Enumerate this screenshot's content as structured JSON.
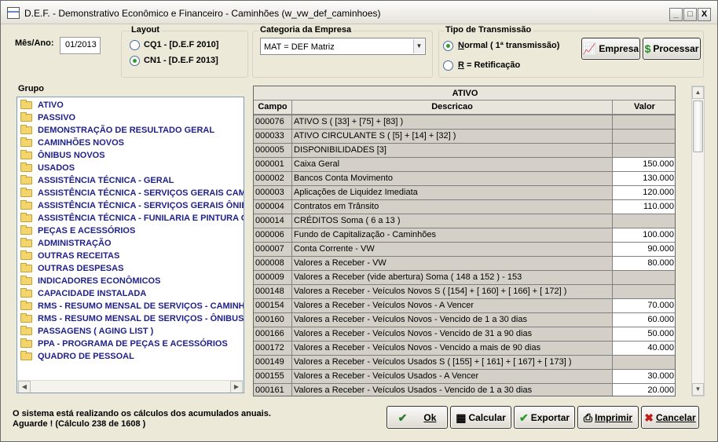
{
  "window": {
    "title": "D.E.F. - Demonstrativo Econômico e Financeiro - Caminhões (w_vw_def_caminhoes)",
    "min": "_",
    "max": "□",
    "close": "X"
  },
  "period": {
    "label": "Mês/Ano:",
    "value": "01/2013"
  },
  "layout": {
    "label": "Layout",
    "opt1": "CQ1 - [D.E.F 2010]",
    "opt2": "CN1 - [D.E.F 2013]",
    "selected": "CN1 - [D.E.F 2013]"
  },
  "category": {
    "label": "Categoria da Empresa",
    "value": "MAT = DEF Matriz"
  },
  "transmission": {
    "label": "Tipo de Transmissão",
    "opt_normal_key": "N",
    "opt_normal_rest": "ormal ( 1ª transmissão)",
    "opt_retif_key": "R",
    "opt_retif_rest": " = Retificação",
    "selected": "Normal"
  },
  "buttons": {
    "empresa": "Empresa",
    "processar": "Processar",
    "ok": "Ok",
    "calcular": "Calcular",
    "exportar": "Exportar",
    "imprimir": "Imprimir",
    "cancelar": "Cancelar"
  },
  "group": {
    "label": "Grupo",
    "items": [
      "ATIVO",
      "PASSIVO",
      "DEMONSTRAÇÃO DE RESULTADO GERAL",
      "CAMINHÕES NOVOS",
      "ÔNIBUS NOVOS",
      "USADOS",
      "ASSISTÊNCIA TÉCNICA - GERAL",
      "ASSISTÊNCIA TÉCNICA - SERVIÇOS GERAIS CAMIN",
      "ASSISTÊNCIA TÉCNICA - SERVIÇOS GERAIS ÔNIBU",
      "ASSISTÊNCIA TÉCNICA - FUNILARIA E PINTURA GE",
      "PEÇAS E ACESSÓRIOS",
      "ADMINISTRAÇÃO",
      "OUTRAS RECEITAS",
      "OUTRAS DESPESAS",
      "INDICADORES ECONÔMICOS",
      "CAPACIDADE INSTALADA",
      "RMS - RESUMO MENSAL DE SERVIÇOS - CAMINHÕ",
      "RMS - RESUMO MENSAL DE SERVIÇOS - ÔNIBUS",
      "PASSAGENS ( AGING LIST )",
      "PPA - PROGRAMA DE PEÇAS E ACESSÓRIOS",
      "QUADRO DE PESSOAL"
    ]
  },
  "grid": {
    "title": "ATIVO",
    "columns": [
      "Campo",
      "Descricao",
      "Valor"
    ],
    "rows": [
      [
        "000076",
        "ATIVO S ( [33] + [75] + [83] )",
        ""
      ],
      [
        "000033",
        "ATIVO CIRCULANTE S ( [5] + [14] + [32] )",
        ""
      ],
      [
        "000005",
        "DISPONIBILIDADES [3]",
        ""
      ],
      [
        "000001",
        "Caixa Geral",
        "150.000"
      ],
      [
        "000002",
        "Bancos Conta Movimento",
        "130.000"
      ],
      [
        "000003",
        "Aplicações de Liquidez Imediata",
        "120.000"
      ],
      [
        "000004",
        "Contratos em Trânsito",
        "110.000"
      ],
      [
        "000014",
        "CRÉDITOS Soma ( 6 a 13 )",
        ""
      ],
      [
        "000006",
        "Fundo de Capitalização - Caminhões",
        "100.000"
      ],
      [
        "000007",
        "Conta Corrente - VW",
        "90.000"
      ],
      [
        "000008",
        "Valores a Receber - VW",
        "80.000"
      ],
      [
        "000009",
        "Valores a Receber (vide abertura) Soma ( 148 a 152 ) - 153",
        ""
      ],
      [
        "000148",
        "Valores a Receber - Veículos Novos S ( [154] + [ 160] + [ 166] + [ 172] )",
        ""
      ],
      [
        "000154",
        "Valores a Receber - Veículos Novos - A Vencer",
        "70.000"
      ],
      [
        "000160",
        "Valores a Receber - Veículos Novos - Vencido de 1 a 30 dias",
        "60.000"
      ],
      [
        "000166",
        "Valores a Receber - Veículos Novos - Vencido de 31 a 90 dias",
        "50.000"
      ],
      [
        "000172",
        "Valores a Receber - Veículos Novos - Vencido a mais de 90 dias",
        "40.000"
      ],
      [
        "000149",
        "Valores a Receber - Veículos Usados S ( [155] + [ 161] + [ 167] + [ 173] )",
        ""
      ],
      [
        "000155",
        "Valores a Receber - Veículos Usados - A Vencer",
        "30.000"
      ],
      [
        "000161",
        "Valores a Receber - Veículos Usados - Vencido de 1 a 30 dias",
        "20.000"
      ]
    ]
  },
  "status": {
    "line1": "O sistema está realizando os cálculos dos acumulados anuais.",
    "line2": "Aguarde ! (Cálculo 238 de 1608 )"
  }
}
